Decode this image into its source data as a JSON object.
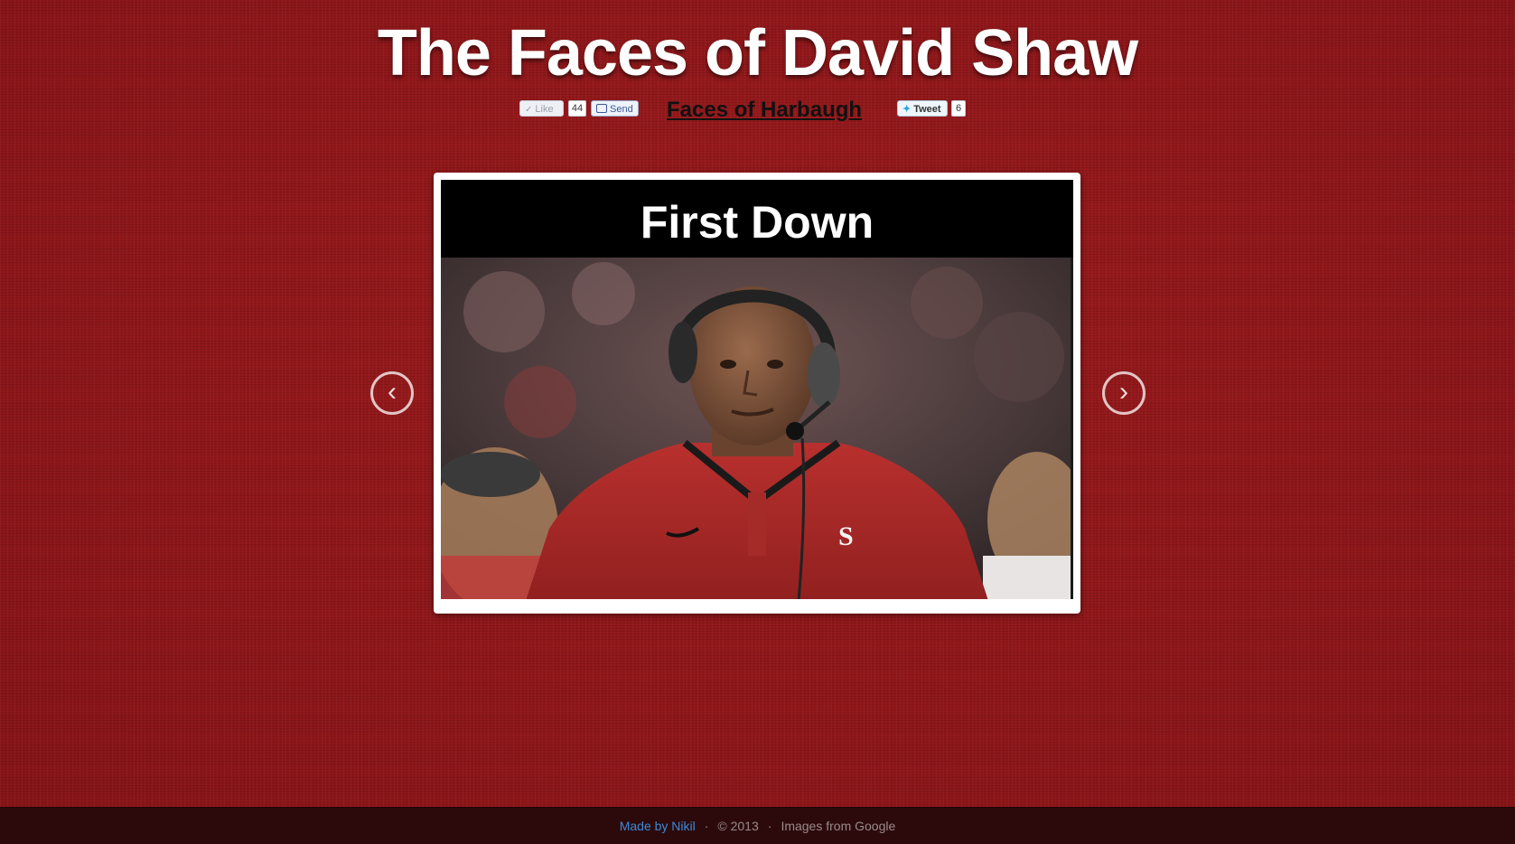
{
  "page": {
    "title": "The Faces of David Shaw",
    "background_color": "#8e1518"
  },
  "social": {
    "like_label": "Like",
    "like_count": "44",
    "send_label": "Send",
    "harbaugh_link": "Faces of Harbaugh",
    "tweet_label": "Tweet",
    "tweet_count": "6"
  },
  "slider": {
    "caption": "First Down",
    "prev_symbol": "‹",
    "next_symbol": "›",
    "image_alt": "David Shaw on the sideline wearing headset and red polo"
  },
  "footer": {
    "made_by": "Made by Nikil",
    "copyright": "© 2013",
    "images_credit": "Images from Google",
    "separator": "·",
    "link_color": "#3a8ad8",
    "background_color": "#2c0a0b"
  }
}
